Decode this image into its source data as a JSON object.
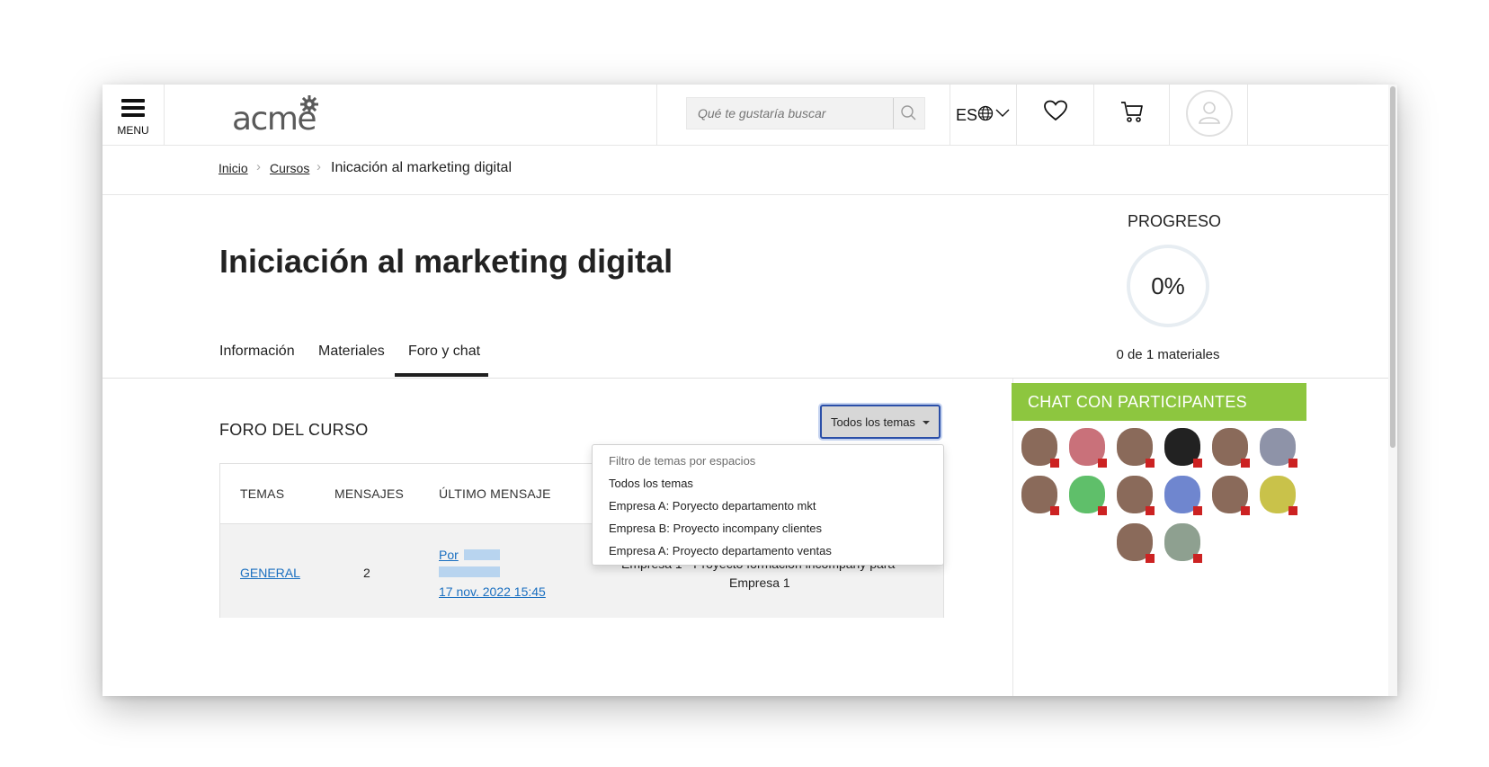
{
  "header": {
    "menu_label": "MENU",
    "logo_text": "acme",
    "search_placeholder": "Qué te gustaría buscar",
    "language": "ES",
    "icons": [
      "hamburger-icon",
      "search-icon",
      "globe-icon",
      "chevron-down-icon",
      "heart-icon",
      "cart-icon",
      "user-icon"
    ]
  },
  "breadcrumb": {
    "items": [
      "Inicio",
      "Cursos"
    ],
    "current": "Inicación al marketing digital"
  },
  "course": {
    "title": "Iniciación al marketing digital",
    "tabs": [
      "Información",
      "Materiales",
      "Foro y chat"
    ],
    "active_tab": "Foro y chat"
  },
  "progress": {
    "label": "PROGRESO",
    "value": "0%",
    "sub": "0 de 1 materiales"
  },
  "forum": {
    "title": "FORO DEL CURSO",
    "filter_button": "Todos los temas",
    "dropdown": {
      "header": "Filtro de temas por espacios",
      "options": [
        "Todos los temas",
        "Empresa A: Poryecto departamento mkt",
        "Empresa B: Proyecto incompany clientes",
        "Empresa A: Proyecto departamento ventas"
      ]
    },
    "columns": [
      "TEMAS",
      "MENSAJES",
      "ÚLTIMO MENSAJE"
    ],
    "rows": [
      {
        "topic": "GENERAL",
        "messages": "2",
        "last_by": "Por",
        "last_date": "17 nov. 2022 15:45",
        "space_line1": "Empresa 1 - Proyecto formación incompany para",
        "space_line2": "Empresa 1"
      }
    ]
  },
  "chat": {
    "title": "CHAT CON PARTICIPANTES",
    "participants": [
      {
        "color": "#8a6a5a"
      },
      {
        "color": "#c9717a"
      },
      {
        "color": "#8a6a5a"
      },
      {
        "color": "#222222"
      },
      {
        "color": "#8a6a5a"
      },
      {
        "color": "#8e93a8"
      },
      {
        "color": "#8a6a5a"
      },
      {
        "color": "#5fbf6a"
      },
      {
        "color": "#8a6a5a"
      },
      {
        "color": "#6f86cf"
      },
      {
        "color": "#8a6a5a"
      },
      {
        "color": "#c9c24a"
      },
      {
        "color": "#8a6a5a"
      },
      {
        "color": "#8ea090"
      }
    ]
  },
  "colors": {
    "chat_green": "#8dc63f",
    "link_blue": "#1a6fc0",
    "focus_blue": "#2b4fa8"
  }
}
